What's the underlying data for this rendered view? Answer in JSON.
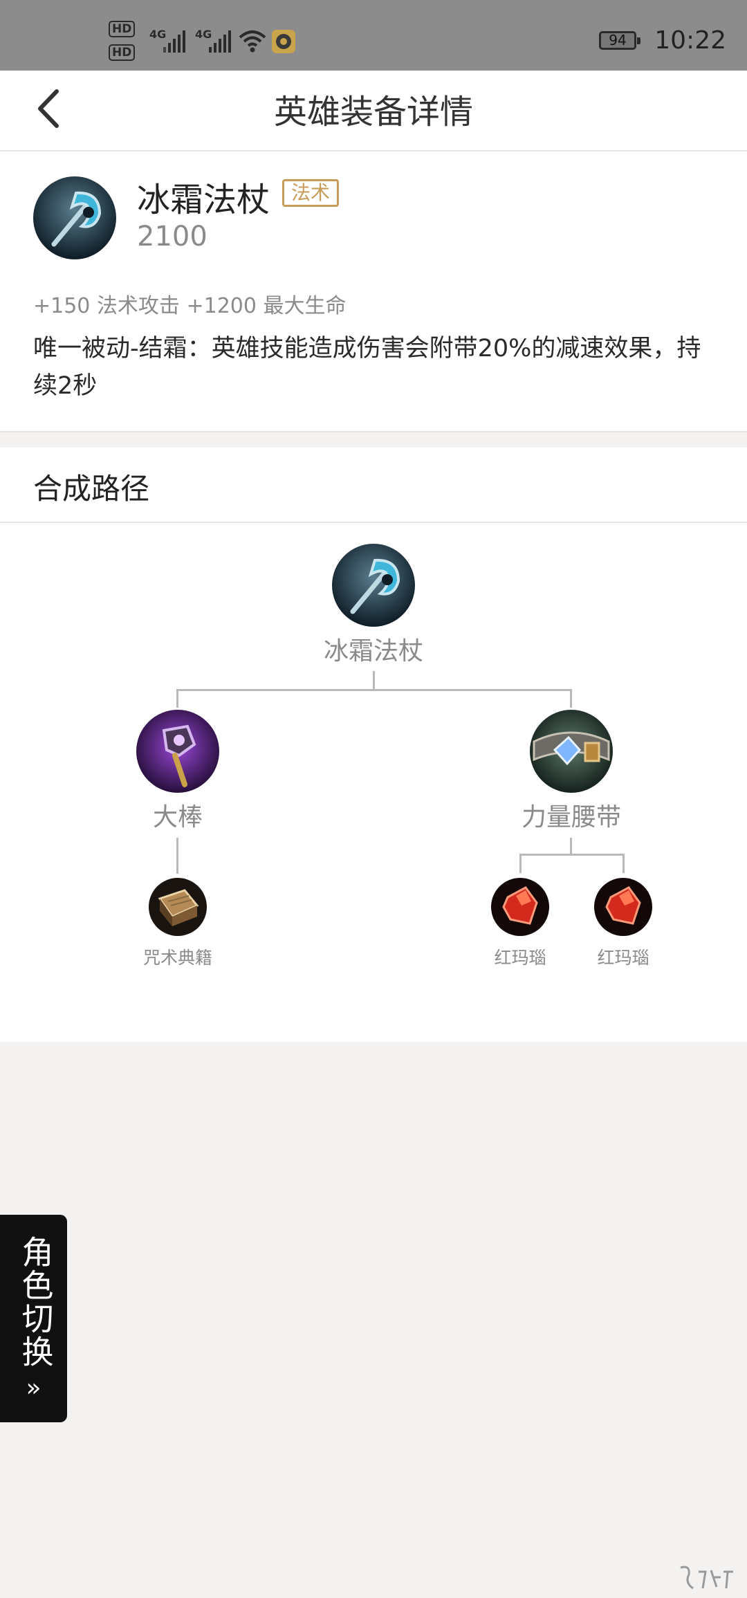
{
  "status_bar": {
    "hd1": "HD",
    "hd2": "HD",
    "net1": "4G",
    "net2": "4G",
    "battery": "94",
    "time": "10:22"
  },
  "header": {
    "title": "英雄装备详情"
  },
  "item": {
    "name": "冰霜法杖",
    "category": "法术",
    "price": "2100",
    "stats": "+150 法术攻击 +1200 最大生命",
    "passive": "唯一被动-结霜：英雄技能造成伤害会附带20%的减速效果，持续2秒"
  },
  "build_path": {
    "section_title": "合成路径",
    "root": "冰霜法杖",
    "left": {
      "name": "大棒",
      "children": [
        "咒术典籍"
      ]
    },
    "right": {
      "name": "力量腰带",
      "children": [
        "红玛瑙",
        "红玛瑙"
      ]
    }
  },
  "side_tab": {
    "label": "角色切换",
    "arrow": "»"
  },
  "colors": {
    "status_bar": "#8c8c8c",
    "badge": "#c79b58",
    "page_bg": "#f3f2f0"
  }
}
